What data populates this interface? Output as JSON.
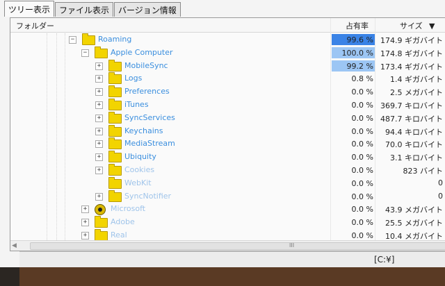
{
  "tabs": [
    {
      "label": "ツリー表示",
      "active": true
    },
    {
      "label": "ファイル表示",
      "active": false
    },
    {
      "label": "バージョン情報",
      "active": false
    }
  ],
  "columns": {
    "folder": "フォルダー",
    "percent": "占有率",
    "size": "サイズ"
  },
  "bar_colors": {
    "strong": "#3a83e6",
    "light": "#9cc6f4"
  },
  "rows": [
    {
      "name": "Roaming",
      "level": 0,
      "icon": "folder-icon",
      "expander": "minus",
      "percent_label": "99.6 %",
      "size": "174.9 ギガバイト",
      "bar_fraction": 0.996,
      "bar": "strong"
    },
    {
      "name": "Apple Computer",
      "level": 1,
      "icon": "folder-icon",
      "expander": "minus",
      "percent_label": "100.0 %",
      "size": "174.8 ギガバイト",
      "bar_fraction": 1.0,
      "bar": "light"
    },
    {
      "name": "MobileSync",
      "level": 2,
      "icon": "folder-icon",
      "expander": "plus",
      "percent_label": "99.2 %",
      "size": "173.4 ギガバイト",
      "bar_fraction": 0.992,
      "bar": "light"
    },
    {
      "name": "Logs",
      "level": 2,
      "icon": "folder-icon",
      "expander": "plus",
      "percent_label": "0.8 %",
      "size": "1.4 ギガバイト",
      "bar_fraction": 0.008,
      "bar": "light"
    },
    {
      "name": "Preferences",
      "level": 2,
      "icon": "folder-icon",
      "expander": "plus",
      "percent_label": "0.0 %",
      "size": "2.5 メガバイト",
      "bar_fraction": 0,
      "bar": "light"
    },
    {
      "name": "iTunes",
      "level": 2,
      "icon": "folder-icon",
      "expander": "plus",
      "percent_label": "0.0 %",
      "size": "369.7 キロバイト",
      "bar_fraction": 0,
      "bar": "light"
    },
    {
      "name": "SyncServices",
      "level": 2,
      "icon": "folder-icon",
      "expander": "plus",
      "percent_label": "0.0 %",
      "size": "487.7 キロバイト",
      "bar_fraction": 0,
      "bar": "light"
    },
    {
      "name": "Keychains",
      "level": 2,
      "icon": "folder-icon",
      "expander": "plus",
      "percent_label": "0.0 %",
      "size": "94.4 キロバイト",
      "bar_fraction": 0,
      "bar": "light"
    },
    {
      "name": "MediaStream",
      "level": 2,
      "icon": "folder-icon",
      "expander": "plus",
      "percent_label": "0.0 %",
      "size": "70.0 キロバイト",
      "bar_fraction": 0,
      "bar": "light"
    },
    {
      "name": "Ubiquity",
      "level": 2,
      "icon": "folder-icon",
      "expander": "plus",
      "percent_label": "0.0 %",
      "size": "3.1 キロバイト",
      "bar_fraction": 0,
      "bar": "light"
    },
    {
      "name": "Cookies",
      "level": 2,
      "icon": "folder-icon",
      "expander": "plus",
      "percent_label": "0.0 %",
      "size": "823 バイト",
      "bar_fraction": 0,
      "bar": "light",
      "faded": true
    },
    {
      "name": "WebKit",
      "level": 2,
      "icon": "folder-icon",
      "expander": "none",
      "percent_label": "0.0 %",
      "size": "0",
      "bar_fraction": 0,
      "bar": "light",
      "faded": true
    },
    {
      "name": "SyncNotifier",
      "level": 2,
      "icon": "folder-icon",
      "expander": "plus",
      "percent_label": "0.0 %",
      "size": "0",
      "bar_fraction": 0,
      "bar": "light",
      "faded": true
    },
    {
      "name": "Microsoft",
      "level": 1,
      "icon": "gear-icon",
      "expander": "plus",
      "percent_label": "0.0 %",
      "size": "43.9 メガバイト",
      "bar_fraction": 0,
      "bar": "light",
      "faded": true
    },
    {
      "name": "Adobe",
      "level": 1,
      "icon": "folder-icon",
      "expander": "plus",
      "percent_label": "0.0 %",
      "size": "25.5 メガバイト",
      "bar_fraction": 0,
      "bar": "light",
      "faded": true
    },
    {
      "name": "Real",
      "level": 1,
      "icon": "folder-icon",
      "expander": "plus",
      "percent_label": "0.0 %",
      "size": "10.4 メガバイト",
      "bar_fraction": 0,
      "bar": "light",
      "faded": true
    }
  ],
  "scrollbar": {
    "grip": "III"
  },
  "status": {
    "drive": "[C:¥]"
  }
}
